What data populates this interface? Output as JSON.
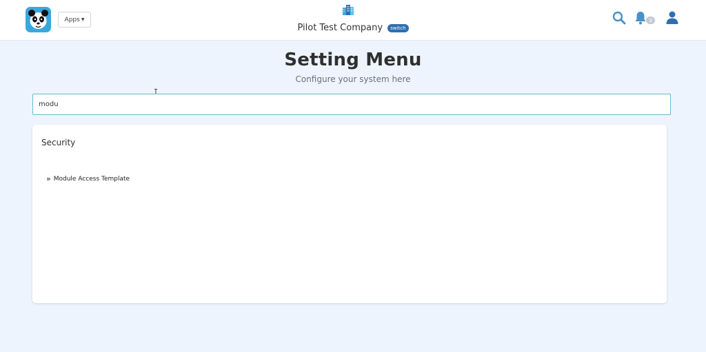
{
  "header": {
    "apps_label": "Apps",
    "company_name": "Pilot Test Company",
    "switch_label": "switch",
    "notification_count": "3"
  },
  "page": {
    "title": "Setting Menu",
    "subtitle": "Configure your system here"
  },
  "search": {
    "value": "modu"
  },
  "results": {
    "section_title": "Security",
    "items": [
      {
        "label": "Module Access Template"
      }
    ]
  },
  "colors": {
    "background": "#edf4fd",
    "accent": "#2d6fb0",
    "logo": "#3aa7dd",
    "input_border": "#6bb6cf"
  },
  "icons": [
    "panda-logo-icon",
    "caret-down-icon",
    "building-icon",
    "search-icon",
    "bell-icon",
    "user-icon",
    "double-chevron-right-icon",
    "text-cursor-icon"
  ]
}
